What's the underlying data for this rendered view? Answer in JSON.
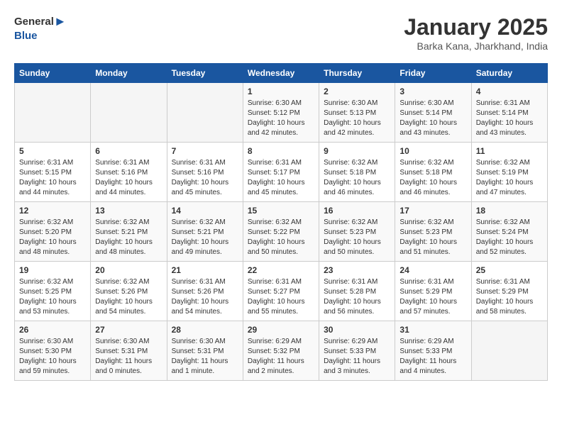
{
  "header": {
    "logo_general": "General",
    "logo_blue": "Blue",
    "month": "January 2025",
    "location": "Barka Kana, Jharkhand, India"
  },
  "days_of_week": [
    "Sunday",
    "Monday",
    "Tuesday",
    "Wednesday",
    "Thursday",
    "Friday",
    "Saturday"
  ],
  "weeks": [
    [
      {
        "day": "",
        "info": ""
      },
      {
        "day": "",
        "info": ""
      },
      {
        "day": "",
        "info": ""
      },
      {
        "day": "1",
        "info": "Sunrise: 6:30 AM\nSunset: 5:12 PM\nDaylight: 10 hours\nand 42 minutes."
      },
      {
        "day": "2",
        "info": "Sunrise: 6:30 AM\nSunset: 5:13 PM\nDaylight: 10 hours\nand 42 minutes."
      },
      {
        "day": "3",
        "info": "Sunrise: 6:30 AM\nSunset: 5:14 PM\nDaylight: 10 hours\nand 43 minutes."
      },
      {
        "day": "4",
        "info": "Sunrise: 6:31 AM\nSunset: 5:14 PM\nDaylight: 10 hours\nand 43 minutes."
      }
    ],
    [
      {
        "day": "5",
        "info": "Sunrise: 6:31 AM\nSunset: 5:15 PM\nDaylight: 10 hours\nand 44 minutes."
      },
      {
        "day": "6",
        "info": "Sunrise: 6:31 AM\nSunset: 5:16 PM\nDaylight: 10 hours\nand 44 minutes."
      },
      {
        "day": "7",
        "info": "Sunrise: 6:31 AM\nSunset: 5:16 PM\nDaylight: 10 hours\nand 45 minutes."
      },
      {
        "day": "8",
        "info": "Sunrise: 6:31 AM\nSunset: 5:17 PM\nDaylight: 10 hours\nand 45 minutes."
      },
      {
        "day": "9",
        "info": "Sunrise: 6:32 AM\nSunset: 5:18 PM\nDaylight: 10 hours\nand 46 minutes."
      },
      {
        "day": "10",
        "info": "Sunrise: 6:32 AM\nSunset: 5:18 PM\nDaylight: 10 hours\nand 46 minutes."
      },
      {
        "day": "11",
        "info": "Sunrise: 6:32 AM\nSunset: 5:19 PM\nDaylight: 10 hours\nand 47 minutes."
      }
    ],
    [
      {
        "day": "12",
        "info": "Sunrise: 6:32 AM\nSunset: 5:20 PM\nDaylight: 10 hours\nand 48 minutes."
      },
      {
        "day": "13",
        "info": "Sunrise: 6:32 AM\nSunset: 5:21 PM\nDaylight: 10 hours\nand 48 minutes."
      },
      {
        "day": "14",
        "info": "Sunrise: 6:32 AM\nSunset: 5:21 PM\nDaylight: 10 hours\nand 49 minutes."
      },
      {
        "day": "15",
        "info": "Sunrise: 6:32 AM\nSunset: 5:22 PM\nDaylight: 10 hours\nand 50 minutes."
      },
      {
        "day": "16",
        "info": "Sunrise: 6:32 AM\nSunset: 5:23 PM\nDaylight: 10 hours\nand 50 minutes."
      },
      {
        "day": "17",
        "info": "Sunrise: 6:32 AM\nSunset: 5:23 PM\nDaylight: 10 hours\nand 51 minutes."
      },
      {
        "day": "18",
        "info": "Sunrise: 6:32 AM\nSunset: 5:24 PM\nDaylight: 10 hours\nand 52 minutes."
      }
    ],
    [
      {
        "day": "19",
        "info": "Sunrise: 6:32 AM\nSunset: 5:25 PM\nDaylight: 10 hours\nand 53 minutes."
      },
      {
        "day": "20",
        "info": "Sunrise: 6:32 AM\nSunset: 5:26 PM\nDaylight: 10 hours\nand 54 minutes."
      },
      {
        "day": "21",
        "info": "Sunrise: 6:31 AM\nSunset: 5:26 PM\nDaylight: 10 hours\nand 54 minutes."
      },
      {
        "day": "22",
        "info": "Sunrise: 6:31 AM\nSunset: 5:27 PM\nDaylight: 10 hours\nand 55 minutes."
      },
      {
        "day": "23",
        "info": "Sunrise: 6:31 AM\nSunset: 5:28 PM\nDaylight: 10 hours\nand 56 minutes."
      },
      {
        "day": "24",
        "info": "Sunrise: 6:31 AM\nSunset: 5:29 PM\nDaylight: 10 hours\nand 57 minutes."
      },
      {
        "day": "25",
        "info": "Sunrise: 6:31 AM\nSunset: 5:29 PM\nDaylight: 10 hours\nand 58 minutes."
      }
    ],
    [
      {
        "day": "26",
        "info": "Sunrise: 6:30 AM\nSunset: 5:30 PM\nDaylight: 10 hours\nand 59 minutes."
      },
      {
        "day": "27",
        "info": "Sunrise: 6:30 AM\nSunset: 5:31 PM\nDaylight: 11 hours\nand 0 minutes."
      },
      {
        "day": "28",
        "info": "Sunrise: 6:30 AM\nSunset: 5:31 PM\nDaylight: 11 hours\nand 1 minute."
      },
      {
        "day": "29",
        "info": "Sunrise: 6:29 AM\nSunset: 5:32 PM\nDaylight: 11 hours\nand 2 minutes."
      },
      {
        "day": "30",
        "info": "Sunrise: 6:29 AM\nSunset: 5:33 PM\nDaylight: 11 hours\nand 3 minutes."
      },
      {
        "day": "31",
        "info": "Sunrise: 6:29 AM\nSunset: 5:33 PM\nDaylight: 11 hours\nand 4 minutes."
      },
      {
        "day": "",
        "info": ""
      }
    ]
  ]
}
